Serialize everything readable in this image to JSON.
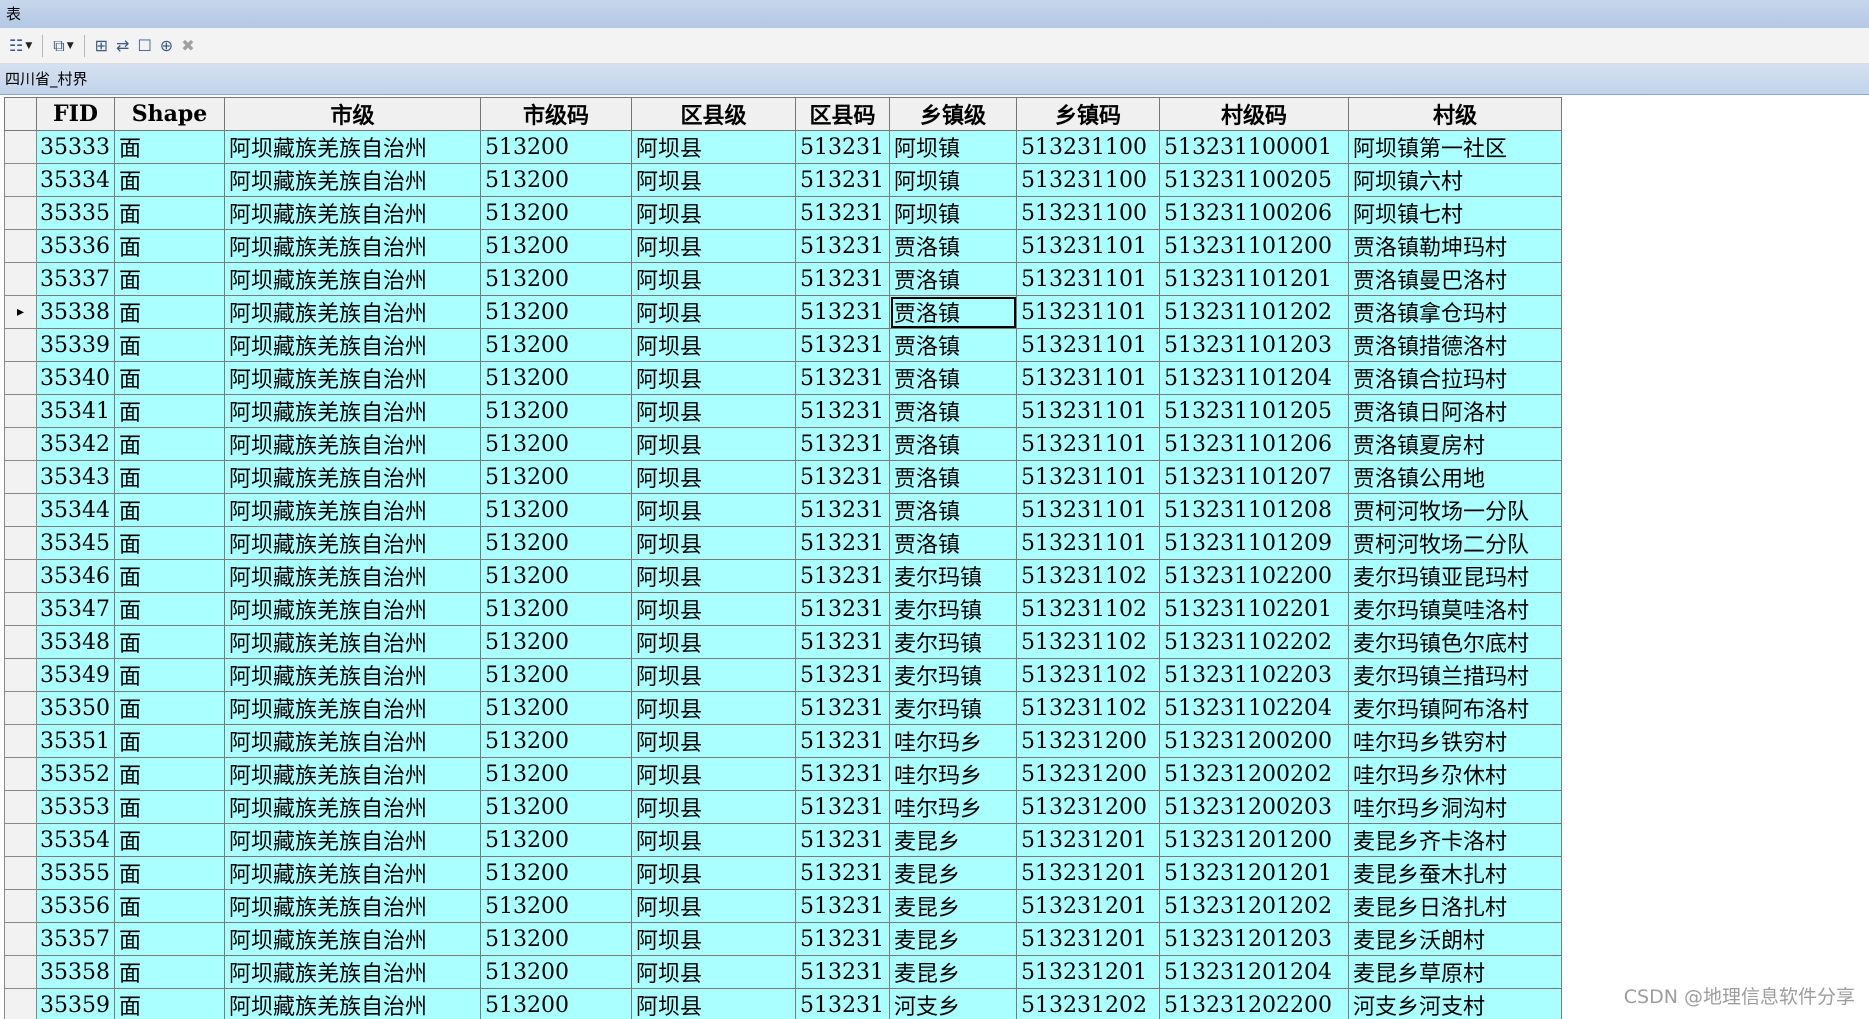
{
  "window": {
    "title": "表"
  },
  "toolbar": {
    "table_options_icon": "table-options-icon",
    "related_tables_icon": "related-tables-icon",
    "select_by_attributes_icon": "select-by-attributes-icon",
    "switch_selection_icon": "switch-selection-icon",
    "clear_selection_icon": "clear-selection-icon",
    "zoom_to_selected_icon": "zoom-to-selected-icon",
    "delete_selected_icon": "delete-selected-icon"
  },
  "tab": {
    "label": "四川省_村界"
  },
  "grid": {
    "columns": [
      "FID",
      "Shape",
      "市级",
      "市级码",
      "区县级",
      "区县码",
      "乡镇级",
      "乡镇码",
      "村级码",
      "村级"
    ],
    "rows": [
      [
        "35333",
        "面",
        "阿坝藏族羌族自治州",
        "513200",
        "阿坝县",
        "513231",
        "阿坝镇",
        "513231100",
        "513231100001",
        "阿坝镇第一社区"
      ],
      [
        "35334",
        "面",
        "阿坝藏族羌族自治州",
        "513200",
        "阿坝县",
        "513231",
        "阿坝镇",
        "513231100",
        "513231100205",
        "阿坝镇六村"
      ],
      [
        "35335",
        "面",
        "阿坝藏族羌族自治州",
        "513200",
        "阿坝县",
        "513231",
        "阿坝镇",
        "513231100",
        "513231100206",
        "阿坝镇七村"
      ],
      [
        "35336",
        "面",
        "阿坝藏族羌族自治州",
        "513200",
        "阿坝县",
        "513231",
        "贾洛镇",
        "513231101",
        "513231101200",
        "贾洛镇勒坤玛村"
      ],
      [
        "35337",
        "面",
        "阿坝藏族羌族自治州",
        "513200",
        "阿坝县",
        "513231",
        "贾洛镇",
        "513231101",
        "513231101201",
        "贾洛镇曼巴洛村"
      ],
      [
        "35338",
        "面",
        "阿坝藏族羌族自治州",
        "513200",
        "阿坝县",
        "513231",
        "贾洛镇",
        "513231101",
        "513231101202",
        "贾洛镇拿仓玛村"
      ],
      [
        "35339",
        "面",
        "阿坝藏族羌族自治州",
        "513200",
        "阿坝县",
        "513231",
        "贾洛镇",
        "513231101",
        "513231101203",
        "贾洛镇措德洛村"
      ],
      [
        "35340",
        "面",
        "阿坝藏族羌族自治州",
        "513200",
        "阿坝县",
        "513231",
        "贾洛镇",
        "513231101",
        "513231101204",
        "贾洛镇合拉玛村"
      ],
      [
        "35341",
        "面",
        "阿坝藏族羌族自治州",
        "513200",
        "阿坝县",
        "513231",
        "贾洛镇",
        "513231101",
        "513231101205",
        "贾洛镇日阿洛村"
      ],
      [
        "35342",
        "面",
        "阿坝藏族羌族自治州",
        "513200",
        "阿坝县",
        "513231",
        "贾洛镇",
        "513231101",
        "513231101206",
        "贾洛镇夏房村"
      ],
      [
        "35343",
        "面",
        "阿坝藏族羌族自治州",
        "513200",
        "阿坝县",
        "513231",
        "贾洛镇",
        "513231101",
        "513231101207",
        "贾洛镇公用地"
      ],
      [
        "35344",
        "面",
        "阿坝藏族羌族自治州",
        "513200",
        "阿坝县",
        "513231",
        "贾洛镇",
        "513231101",
        "513231101208",
        "贾柯河牧场一分队"
      ],
      [
        "35345",
        "面",
        "阿坝藏族羌族自治州",
        "513200",
        "阿坝县",
        "513231",
        "贾洛镇",
        "513231101",
        "513231101209",
        "贾柯河牧场二分队"
      ],
      [
        "35346",
        "面",
        "阿坝藏族羌族自治州",
        "513200",
        "阿坝县",
        "513231",
        "麦尔玛镇",
        "513231102",
        "513231102200",
        "麦尔玛镇亚昆玛村"
      ],
      [
        "35347",
        "面",
        "阿坝藏族羌族自治州",
        "513200",
        "阿坝县",
        "513231",
        "麦尔玛镇",
        "513231102",
        "513231102201",
        "麦尔玛镇莫哇洛村"
      ],
      [
        "35348",
        "面",
        "阿坝藏族羌族自治州",
        "513200",
        "阿坝县",
        "513231",
        "麦尔玛镇",
        "513231102",
        "513231102202",
        "麦尔玛镇色尔底村"
      ],
      [
        "35349",
        "面",
        "阿坝藏族羌族自治州",
        "513200",
        "阿坝县",
        "513231",
        "麦尔玛镇",
        "513231102",
        "513231102203",
        "麦尔玛镇兰措玛村"
      ],
      [
        "35350",
        "面",
        "阿坝藏族羌族自治州",
        "513200",
        "阿坝县",
        "513231",
        "麦尔玛镇",
        "513231102",
        "513231102204",
        "麦尔玛镇阿布洛村"
      ],
      [
        "35351",
        "面",
        "阿坝藏族羌族自治州",
        "513200",
        "阿坝县",
        "513231",
        "哇尔玛乡",
        "513231200",
        "513231200200",
        "哇尔玛乡铁穷村"
      ],
      [
        "35352",
        "面",
        "阿坝藏族羌族自治州",
        "513200",
        "阿坝县",
        "513231",
        "哇尔玛乡",
        "513231200",
        "513231200202",
        "哇尔玛乡尕休村"
      ],
      [
        "35353",
        "面",
        "阿坝藏族羌族自治州",
        "513200",
        "阿坝县",
        "513231",
        "哇尔玛乡",
        "513231200",
        "513231200203",
        "哇尔玛乡洞沟村"
      ],
      [
        "35354",
        "面",
        "阿坝藏族羌族自治州",
        "513200",
        "阿坝县",
        "513231",
        "麦昆乡",
        "513231201",
        "513231201200",
        "麦昆乡齐卡洛村"
      ],
      [
        "35355",
        "面",
        "阿坝藏族羌族自治州",
        "513200",
        "阿坝县",
        "513231",
        "麦昆乡",
        "513231201",
        "513231201201",
        "麦昆乡蚕木扎村"
      ],
      [
        "35356",
        "面",
        "阿坝藏族羌族自治州",
        "513200",
        "阿坝县",
        "513231",
        "麦昆乡",
        "513231201",
        "513231201202",
        "麦昆乡日洛扎村"
      ],
      [
        "35357",
        "面",
        "阿坝藏族羌族自治州",
        "513200",
        "阿坝县",
        "513231",
        "麦昆乡",
        "513231201",
        "513231201203",
        "麦昆乡沃朗村"
      ],
      [
        "35358",
        "面",
        "阿坝藏族羌族自治州",
        "513200",
        "阿坝县",
        "513231",
        "麦昆乡",
        "513231201",
        "513231201204",
        "麦昆乡草原村"
      ],
      [
        "35359",
        "面",
        "阿坝藏族羌族自治州",
        "513200",
        "阿坝县",
        "513231",
        "河支乡",
        "513231202",
        "513231202200",
        "河支乡河支村"
      ]
    ],
    "current_row_index": 5,
    "current_cell_column": 6,
    "row_pointer_glyph": "▸"
  },
  "watermark": {
    "text": "CSDN @地理信息软件分享"
  },
  "colors": {
    "cell_bg": "#aaffff",
    "header_bg": "#f0f0f0",
    "title_bg": "#c6d6ec"
  }
}
